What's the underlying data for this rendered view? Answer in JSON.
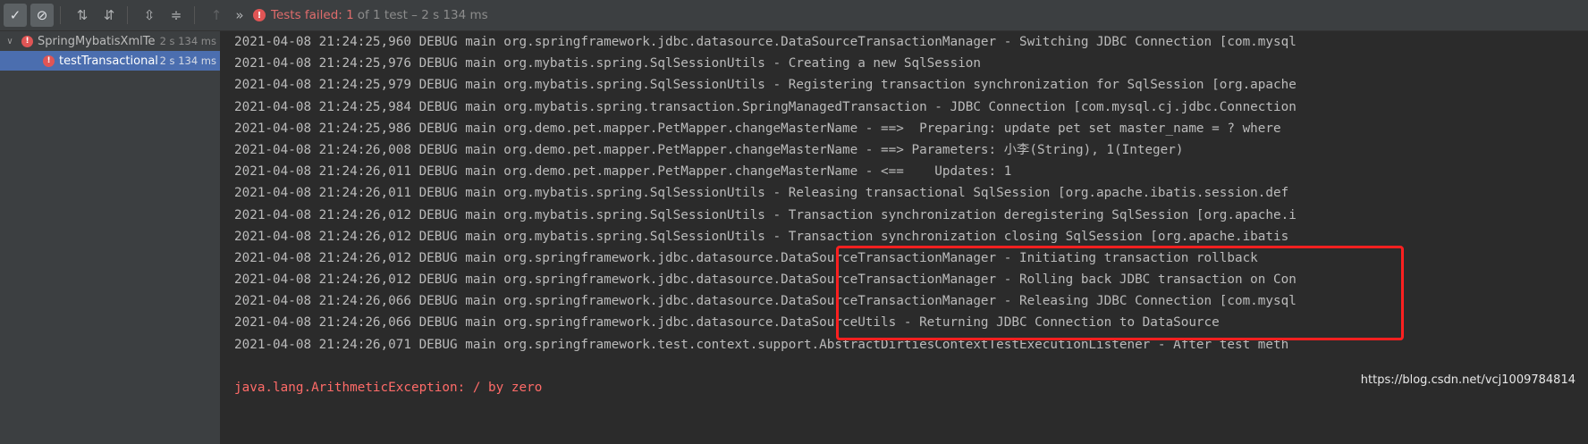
{
  "toolbar": {
    "buttons": [
      {
        "icon": "check-icon",
        "glyph": "✓"
      },
      {
        "icon": "cancel-circle-icon",
        "glyph": "⊘"
      },
      {
        "icon": "sort-alpha-icon",
        "glyph": "⇅"
      },
      {
        "icon": "sort-duration-icon",
        "glyph": "⇵"
      },
      {
        "icon": "expand-all-icon",
        "glyph": "⇳"
      },
      {
        "icon": "collapse-all-icon",
        "glyph": "≑"
      },
      {
        "icon": "arrow-up-icon",
        "glyph": "↑"
      },
      {
        "icon": "chevron-more-icon",
        "glyph": "»"
      }
    ],
    "status_icon": "!",
    "status_failed": "Tests failed: 1",
    "status_rest": "of 1 test – 2 s 134 ms"
  },
  "tree": {
    "items": [
      {
        "chevron": "∨",
        "icon": "!",
        "name": "SpringMybatisXmlTe",
        "time": "2 s 134 ms"
      },
      {
        "icon": "!",
        "name": "testTransactional",
        "time": "2 s 134 ms"
      }
    ]
  },
  "console": {
    "lines": [
      "2021-04-08 21:24:25,960 DEBUG main org.springframework.jdbc.datasource.DataSourceTransactionManager - Switching JDBC Connection [com.mysql",
      "2021-04-08 21:24:25,976 DEBUG main org.mybatis.spring.SqlSessionUtils - Creating a new SqlSession",
      "2021-04-08 21:24:25,979 DEBUG main org.mybatis.spring.SqlSessionUtils - Registering transaction synchronization for SqlSession [org.apache",
      "2021-04-08 21:24:25,984 DEBUG main org.mybatis.spring.transaction.SpringManagedTransaction - JDBC Connection [com.mysql.cj.jdbc.Connection",
      "2021-04-08 21:24:25,986 DEBUG main org.demo.pet.mapper.PetMapper.changeMasterName - ==>  Preparing: update pet set master_name = ? where",
      "2021-04-08 21:24:26,008 DEBUG main org.demo.pet.mapper.PetMapper.changeMasterName - ==> Parameters: 小李(String), 1(Integer)",
      "2021-04-08 21:24:26,011 DEBUG main org.demo.pet.mapper.PetMapper.changeMasterName - <==    Updates: 1",
      "2021-04-08 21:24:26,011 DEBUG main org.mybatis.spring.SqlSessionUtils - Releasing transactional SqlSession [org.apache.ibatis.session.def",
      "2021-04-08 21:24:26,012 DEBUG main org.mybatis.spring.SqlSessionUtils - Transaction synchronization deregistering SqlSession [org.apache.i",
      "2021-04-08 21:24:26,012 DEBUG main org.mybatis.spring.SqlSessionUtils - Transaction synchronization closing SqlSession [org.apache.ibatis",
      "2021-04-08 21:24:26,012 DEBUG main org.springframework.jdbc.datasource.DataSourceTransactionManager - Initiating transaction rollback",
      "2021-04-08 21:24:26,012 DEBUG main org.springframework.jdbc.datasource.DataSourceTransactionManager - Rolling back JDBC transaction on Con",
      "2021-04-08 21:24:26,066 DEBUG main org.springframework.jdbc.datasource.DataSourceTransactionManager - Releasing JDBC Connection [com.mysql",
      "2021-04-08 21:24:26,066 DEBUG main org.springframework.jdbc.datasource.DataSourceUtils - Returning JDBC Connection to DataSource",
      "2021-04-08 21:24:26,071 DEBUG main org.springframework.test.context.support.AbstractDirtiesContextTestExecutionListener - After test meth",
      "",
      "java.lang.ArithmeticException: / by zero"
    ]
  },
  "watermark": "https://blog.csdn.net/vcj1009784814"
}
